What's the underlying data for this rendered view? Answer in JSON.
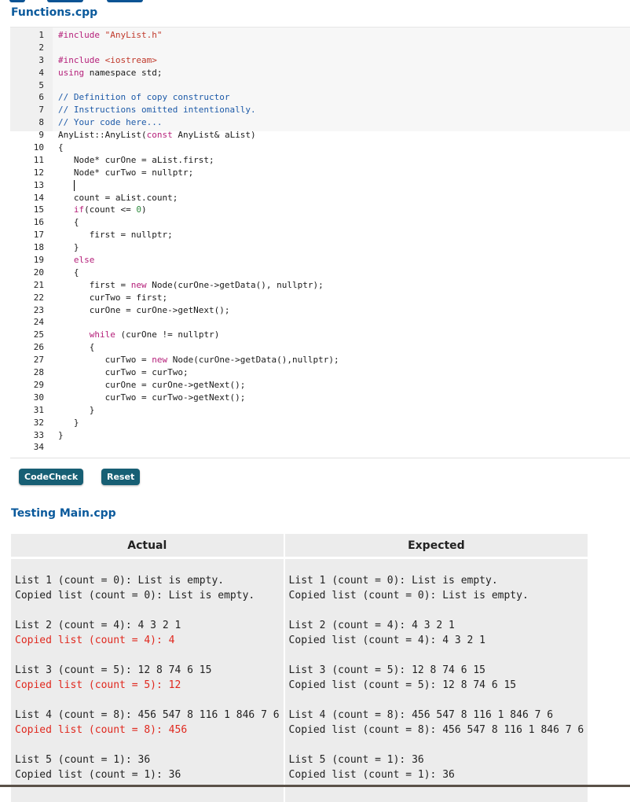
{
  "file": {
    "name": "Functions.cpp"
  },
  "editor": {
    "lines": [
      {
        "n": "1",
        "tokens": [
          {
            "t": "#include ",
            "c": "kw"
          },
          {
            "t": "\"AnyList.h\"",
            "c": "str"
          }
        ]
      },
      {
        "n": "2",
        "tokens": []
      },
      {
        "n": "3",
        "tokens": [
          {
            "t": "#include ",
            "c": "kw"
          },
          {
            "t": "<iostream>",
            "c": "str"
          }
        ]
      },
      {
        "n": "4",
        "tokens": [
          {
            "t": "using",
            "c": "kw"
          },
          {
            "t": " namespace std;",
            "c": ""
          }
        ]
      },
      {
        "n": "5",
        "tokens": []
      },
      {
        "n": "6",
        "tokens": [
          {
            "t": "// Definition of copy constructor",
            "c": "com"
          }
        ]
      },
      {
        "n": "7",
        "tokens": [
          {
            "t": "// Instructions omitted intentionally.",
            "c": "com"
          }
        ]
      },
      {
        "n": "8",
        "tokens": [
          {
            "t": "// Your code here...",
            "c": "com"
          }
        ]
      },
      {
        "n": "9",
        "tokens": [
          {
            "t": "AnyList::AnyList(",
            "c": ""
          },
          {
            "t": "const",
            "c": "kw"
          },
          {
            "t": " AnyList& aList)",
            "c": ""
          }
        ]
      },
      {
        "n": "10",
        "tokens": [
          {
            "t": "{",
            "c": ""
          }
        ]
      },
      {
        "n": "11",
        "tokens": [
          {
            "t": "   Node* curOne = aList.first;",
            "c": ""
          }
        ]
      },
      {
        "n": "12",
        "tokens": [
          {
            "t": "   Node* curTwo = nullptr;",
            "c": ""
          }
        ]
      },
      {
        "n": "13",
        "tokens": [
          {
            "t": "   ",
            "c": ""
          }
        ],
        "cursor": true
      },
      {
        "n": "14",
        "tokens": [
          {
            "t": "   count = aList.count;",
            "c": ""
          }
        ]
      },
      {
        "n": "15",
        "tokens": [
          {
            "t": "   ",
            "c": ""
          },
          {
            "t": "if",
            "c": "kw"
          },
          {
            "t": "(count <= ",
            "c": ""
          },
          {
            "t": "0",
            "c": "num"
          },
          {
            "t": ")",
            "c": ""
          }
        ]
      },
      {
        "n": "16",
        "tokens": [
          {
            "t": "   {",
            "c": ""
          }
        ]
      },
      {
        "n": "17",
        "tokens": [
          {
            "t": "      first = nullptr;",
            "c": ""
          }
        ]
      },
      {
        "n": "18",
        "tokens": [
          {
            "t": "   }",
            "c": ""
          }
        ]
      },
      {
        "n": "19",
        "tokens": [
          {
            "t": "   ",
            "c": ""
          },
          {
            "t": "else",
            "c": "kw"
          }
        ]
      },
      {
        "n": "20",
        "tokens": [
          {
            "t": "   {",
            "c": ""
          }
        ]
      },
      {
        "n": "21",
        "tokens": [
          {
            "t": "      first = ",
            "c": ""
          },
          {
            "t": "new",
            "c": "kw"
          },
          {
            "t": " Node(curOne->getData(), nullptr);",
            "c": ""
          }
        ]
      },
      {
        "n": "22",
        "tokens": [
          {
            "t": "      curTwo = first;",
            "c": ""
          }
        ]
      },
      {
        "n": "23",
        "tokens": [
          {
            "t": "      curOne = curOne->getNext();",
            "c": ""
          }
        ]
      },
      {
        "n": "24",
        "tokens": []
      },
      {
        "n": "25",
        "tokens": [
          {
            "t": "      ",
            "c": ""
          },
          {
            "t": "while",
            "c": "kw"
          },
          {
            "t": " (curOne != nullptr)",
            "c": ""
          }
        ]
      },
      {
        "n": "26",
        "tokens": [
          {
            "t": "      {",
            "c": ""
          }
        ]
      },
      {
        "n": "27",
        "tokens": [
          {
            "t": "         curTwo = ",
            "c": ""
          },
          {
            "t": "new",
            "c": "kw"
          },
          {
            "t": " Node(curOne->getData(),nullptr);",
            "c": ""
          }
        ]
      },
      {
        "n": "28",
        "tokens": [
          {
            "t": "         curTwo = curTwo;",
            "c": ""
          }
        ]
      },
      {
        "n": "29",
        "tokens": [
          {
            "t": "         curOne = curOne->getNext();",
            "c": ""
          }
        ]
      },
      {
        "n": "30",
        "tokens": [
          {
            "t": "         curTwo = curTwo->getNext();",
            "c": ""
          }
        ]
      },
      {
        "n": "31",
        "tokens": [
          {
            "t": "      }",
            "c": ""
          }
        ]
      },
      {
        "n": "32",
        "tokens": [
          {
            "t": "   }",
            "c": ""
          }
        ]
      },
      {
        "n": "33",
        "tokens": [
          {
            "t": "}",
            "c": ""
          }
        ]
      },
      {
        "n": "34",
        "tokens": []
      }
    ]
  },
  "buttons": {
    "codecheck": "CodeCheck",
    "reset": "Reset"
  },
  "testing": {
    "title": "Testing Main.cpp",
    "headers": {
      "actual": "Actual",
      "expected": "Expected"
    },
    "actual": [
      [
        {
          "text": "List 1 (count = 0): List is empty.",
          "error": false
        },
        {
          "text": "Copied list (count = 0): List is empty.",
          "error": false
        }
      ],
      [
        {
          "text": "List 2 (count = 4): 4 3 2 1",
          "error": false
        },
        {
          "text": "Copied list (count = 4): 4",
          "error": true
        }
      ],
      [
        {
          "text": "List 3 (count = 5): 12 8 74 6 15",
          "error": false
        },
        {
          "text": "Copied list (count = 5): 12",
          "error": true
        }
      ],
      [
        {
          "text": "List 4 (count = 8): 456 547 8 116 1 846 7 6",
          "error": false
        },
        {
          "text": "Copied list (count = 8): 456",
          "error": true
        }
      ],
      [
        {
          "text": "List 5 (count = 1): 36",
          "error": false
        },
        {
          "text": "Copied list (count = 1): 36",
          "error": false
        }
      ]
    ],
    "expected": [
      [
        {
          "text": "List 1 (count = 0): List is empty.",
          "error": false
        },
        {
          "text": "Copied list (count = 0): List is empty.",
          "error": false
        }
      ],
      [
        {
          "text": "List 2 (count = 4): 4 3 2 1",
          "error": false
        },
        {
          "text": "Copied list (count = 4): 4 3 2 1",
          "error": false
        }
      ],
      [
        {
          "text": "List 3 (count = 5): 12 8 74 6 15",
          "error": false
        },
        {
          "text": "Copied list (count = 5): 12 8 74 6 15",
          "error": false
        }
      ],
      [
        {
          "text": "List 4 (count = 8): 456 547 8 116 1 846 7 6",
          "error": false
        },
        {
          "text": "Copied list (count = 8): 456 547 8 116 1 846 7 6",
          "error": false
        }
      ],
      [
        {
          "text": "List 5 (count = 1): 36",
          "error": false
        },
        {
          "text": "Copied list (count = 1): 36",
          "error": false
        }
      ]
    ]
  },
  "colors": {
    "title": "#0b5a9c",
    "button": "#175f74",
    "error": "#e0281e",
    "keyword": "#b5207a",
    "string": "#c0392b",
    "comment": "#1d5aa8",
    "number": "#2e8b3e"
  }
}
